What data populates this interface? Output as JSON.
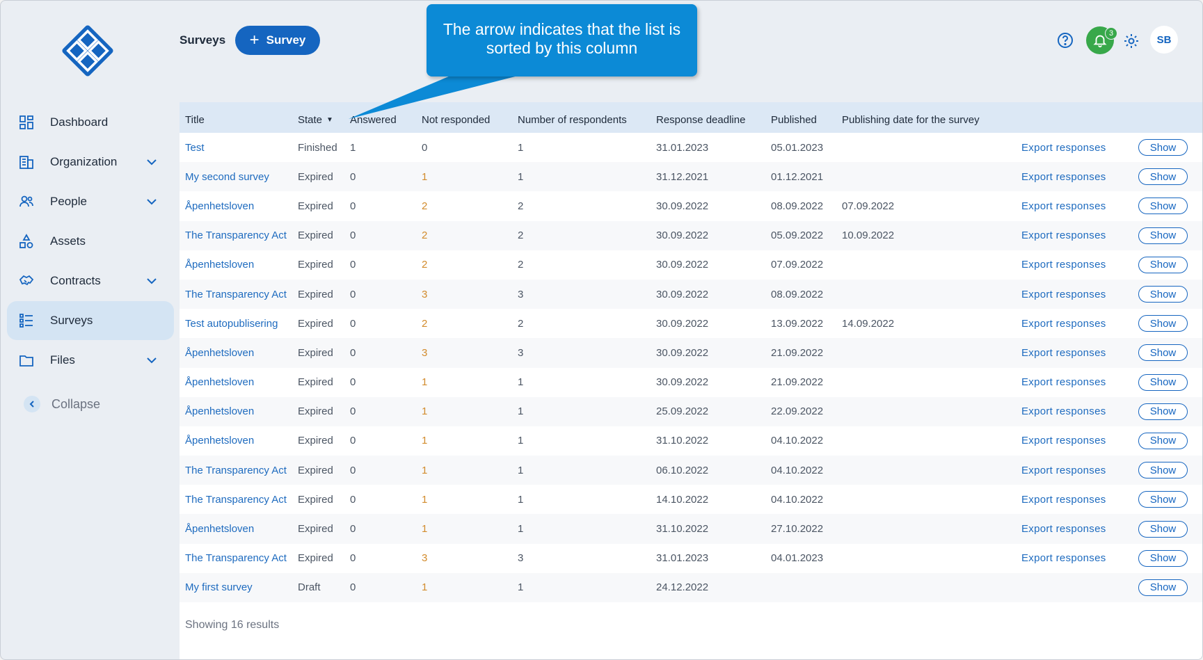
{
  "header": {
    "page_title": "Surveys",
    "add_button_label": "Survey",
    "notifications_count": "3",
    "avatar_initials": "SB"
  },
  "callout": {
    "text": "The arrow indicates that the list is sorted by this column"
  },
  "sidebar": {
    "items": [
      {
        "label": "Dashboard",
        "icon": "dashboard-icon",
        "expandable": false,
        "active": false
      },
      {
        "label": "Organization",
        "icon": "building-icon",
        "expandable": true,
        "active": false
      },
      {
        "label": "People",
        "icon": "people-icon",
        "expandable": true,
        "active": false
      },
      {
        "label": "Assets",
        "icon": "assets-icon",
        "expandable": false,
        "active": false
      },
      {
        "label": "Contracts",
        "icon": "handshake-icon",
        "expandable": true,
        "active": false
      },
      {
        "label": "Surveys",
        "icon": "checklist-icon",
        "expandable": false,
        "active": true
      },
      {
        "label": "Files",
        "icon": "folder-icon",
        "expandable": true,
        "active": false
      }
    ],
    "collapse_label": "Collapse"
  },
  "table": {
    "sorted_by": "State",
    "columns": [
      "Title",
      "State",
      "Answered",
      "Not responded",
      "Number of respondents",
      "Response deadline",
      "Published",
      "Publishing date for the survey"
    ],
    "export_label": "Export responses",
    "show_label": "Show",
    "rows": [
      {
        "title": "Test",
        "state": "Finished",
        "answered": "1",
        "not_responded": "0",
        "respondents": "1",
        "deadline": "31.01.2023",
        "published": "05.01.2023",
        "publishing_date": "",
        "export": true
      },
      {
        "title": "My second survey",
        "state": "Expired",
        "answered": "0",
        "not_responded": "1",
        "respondents": "1",
        "deadline": "31.12.2021",
        "published": "01.12.2021",
        "publishing_date": "",
        "export": true
      },
      {
        "title": "Åpenhetsloven",
        "state": "Expired",
        "answered": "0",
        "not_responded": "2",
        "respondents": "2",
        "deadline": "30.09.2022",
        "published": "08.09.2022",
        "publishing_date": "07.09.2022",
        "export": true
      },
      {
        "title": "The Transparency Act",
        "state": "Expired",
        "answered": "0",
        "not_responded": "2",
        "respondents": "2",
        "deadline": "30.09.2022",
        "published": "05.09.2022",
        "publishing_date": "10.09.2022",
        "export": true
      },
      {
        "title": "Åpenhetsloven",
        "state": "Expired",
        "answered": "0",
        "not_responded": "2",
        "respondents": "2",
        "deadline": "30.09.2022",
        "published": "07.09.2022",
        "publishing_date": "",
        "export": true
      },
      {
        "title": "The Transparency Act",
        "state": "Expired",
        "answered": "0",
        "not_responded": "3",
        "respondents": "3",
        "deadline": "30.09.2022",
        "published": "08.09.2022",
        "publishing_date": "",
        "export": true
      },
      {
        "title": "Test autopublisering",
        "state": "Expired",
        "answered": "0",
        "not_responded": "2",
        "respondents": "2",
        "deadline": "30.09.2022",
        "published": "13.09.2022",
        "publishing_date": "14.09.2022",
        "export": true
      },
      {
        "title": "Åpenhetsloven",
        "state": "Expired",
        "answered": "0",
        "not_responded": "3",
        "respondents": "3",
        "deadline": "30.09.2022",
        "published": "21.09.2022",
        "publishing_date": "",
        "export": true
      },
      {
        "title": "Åpenhetsloven",
        "state": "Expired",
        "answered": "0",
        "not_responded": "1",
        "respondents": "1",
        "deadline": "30.09.2022",
        "published": "21.09.2022",
        "publishing_date": "",
        "export": true
      },
      {
        "title": "Åpenhetsloven",
        "state": "Expired",
        "answered": "0",
        "not_responded": "1",
        "respondents": "1",
        "deadline": "25.09.2022",
        "published": "22.09.2022",
        "publishing_date": "",
        "export": true
      },
      {
        "title": "Åpenhetsloven",
        "state": "Expired",
        "answered": "0",
        "not_responded": "1",
        "respondents": "1",
        "deadline": "31.10.2022",
        "published": "04.10.2022",
        "publishing_date": "",
        "export": true
      },
      {
        "title": "The Transparency Act",
        "state": "Expired",
        "answered": "0",
        "not_responded": "1",
        "respondents": "1",
        "deadline": "06.10.2022",
        "published": "04.10.2022",
        "publishing_date": "",
        "export": true
      },
      {
        "title": "The Transparency Act",
        "state": "Expired",
        "answered": "0",
        "not_responded": "1",
        "respondents": "1",
        "deadline": "14.10.2022",
        "published": "04.10.2022",
        "publishing_date": "",
        "export": true
      },
      {
        "title": "Åpenhetsloven",
        "state": "Expired",
        "answered": "0",
        "not_responded": "1",
        "respondents": "1",
        "deadline": "31.10.2022",
        "published": "27.10.2022",
        "publishing_date": "",
        "export": true
      },
      {
        "title": "The Transparency Act",
        "state": "Expired",
        "answered": "0",
        "not_responded": "3",
        "respondents": "3",
        "deadline": "31.01.2023",
        "published": "04.01.2023",
        "publishing_date": "",
        "export": true
      },
      {
        "title": "My first survey",
        "state": "Draft",
        "answered": "0",
        "not_responded": "1",
        "respondents": "1",
        "deadline": "24.12.2022",
        "published": "",
        "publishing_date": "",
        "export": false
      }
    ],
    "results_text": "Showing 16 results"
  },
  "colors": {
    "primary": "#1565c0",
    "link": "#1e6bbf",
    "callout": "#0c8ad6",
    "notification": "#38a84a",
    "active_nav": "#d4e4f3",
    "header_row": "#dce8f5",
    "not_responded": "#d28b2c"
  }
}
